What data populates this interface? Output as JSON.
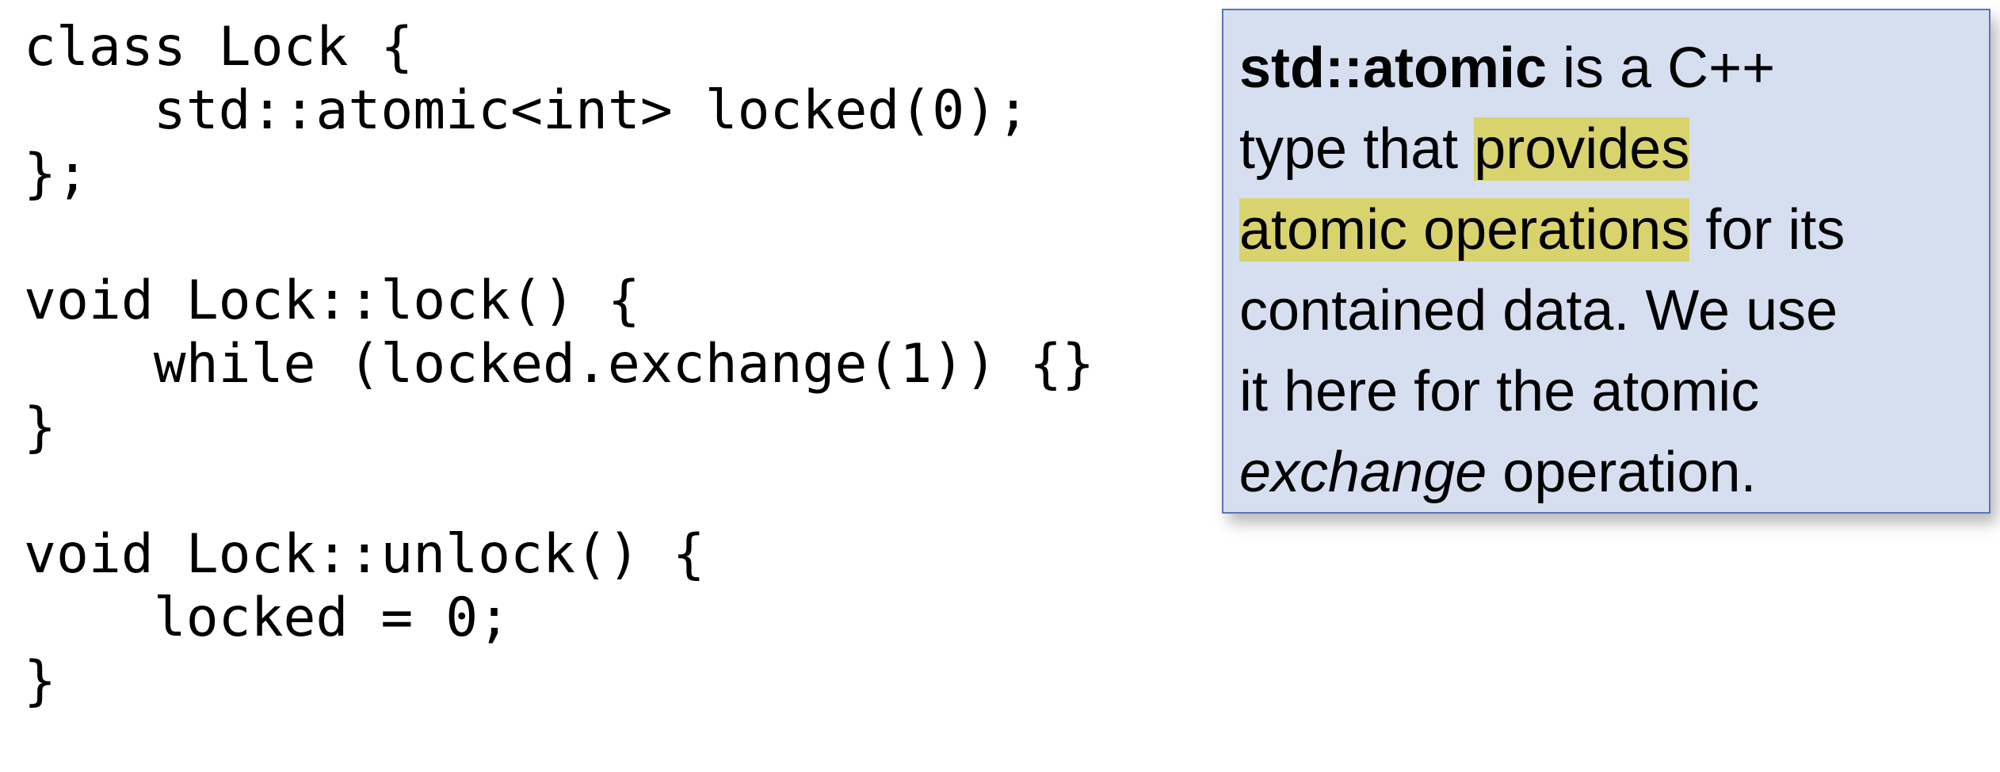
{
  "code": {
    "lines": [
      "class Lock {",
      "    std::atomic<int> locked(0);",
      "};",
      "",
      "void Lock::lock() {",
      "    while (locked.exchange(1)) {}",
      "}",
      "",
      "void Lock::unlock() {",
      "    locked = 0;",
      "}"
    ]
  },
  "callout": {
    "line1_bold": "std::atomic",
    "line1_rest": " is a C++",
    "line2_pre": "type that ",
    "line2_highlight": "provides ",
    "line3_highlight": "atomic operations",
    "line3_rest": " for its",
    "line4": "contained data.  We use",
    "line5": "it here for the atomic",
    "line6_italic": "exchange",
    "line6_rest": " operation.",
    "highlight_color": "#d9d36e",
    "background_color": "#d6dff0",
    "border_color": "#5a77b4"
  }
}
